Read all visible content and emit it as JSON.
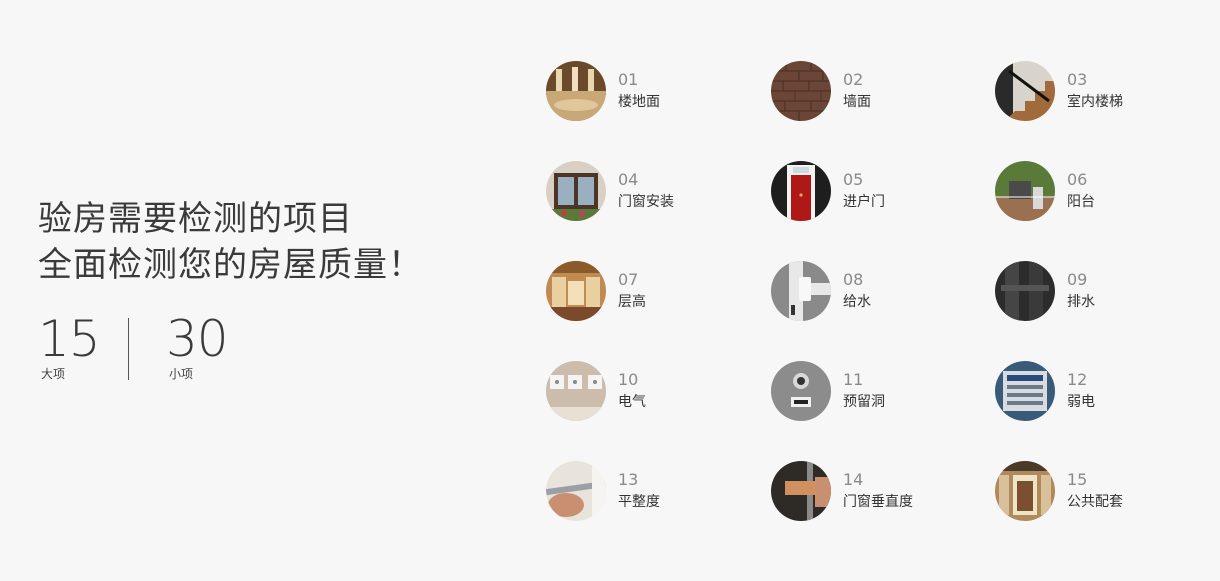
{
  "headline": {
    "line1": "验房需要检测的项目",
    "line2": "全面检测您的房屋质量！"
  },
  "stats": [
    {
      "number": "15",
      "unit": "大项"
    },
    {
      "number": "30",
      "unit": "小项"
    }
  ],
  "items": [
    {
      "index": "01",
      "label": "楼地面",
      "icon": "floor-photo-icon",
      "color": "#8a6a45"
    },
    {
      "index": "02",
      "label": "墙面",
      "icon": "brick-wall-photo-icon",
      "color": "#6e4a3a"
    },
    {
      "index": "03",
      "label": "室内楼梯",
      "icon": "stairs-photo-icon",
      "color": "#4a4038"
    },
    {
      "index": "04",
      "label": "门窗安装",
      "icon": "window-photo-icon",
      "color": "#6a5040"
    },
    {
      "index": "05",
      "label": "进户门",
      "icon": "front-door-photo-icon",
      "color": "#a02020"
    },
    {
      "index": "06",
      "label": "阳台",
      "icon": "balcony-photo-icon",
      "color": "#7a6a50"
    },
    {
      "index": "07",
      "label": "层高",
      "icon": "interior-height-photo-icon",
      "color": "#b08050"
    },
    {
      "index": "08",
      "label": "给水",
      "icon": "water-supply-pipe-photo-icon",
      "color": "#9a9a9a"
    },
    {
      "index": "09",
      "label": "排水",
      "icon": "drain-pipe-photo-icon",
      "color": "#3a3a3a"
    },
    {
      "index": "10",
      "label": "电气",
      "icon": "electrical-outlet-photo-icon",
      "color": "#c8b8a8"
    },
    {
      "index": "11",
      "label": "预留洞",
      "icon": "reserved-hole-photo-icon",
      "color": "#8e8e8e"
    },
    {
      "index": "12",
      "label": "弱电",
      "icon": "weak-current-box-photo-icon",
      "color": "#4a6a8a"
    },
    {
      "index": "13",
      "label": "平整度",
      "icon": "flatness-tool-photo-icon",
      "color": "#7a6858"
    },
    {
      "index": "14",
      "label": "门窗垂直度",
      "icon": "verticality-tool-photo-icon",
      "color": "#3a3028"
    },
    {
      "index": "15",
      "label": "公共配套",
      "icon": "public-facility-photo-icon",
      "color": "#a07850"
    }
  ]
}
